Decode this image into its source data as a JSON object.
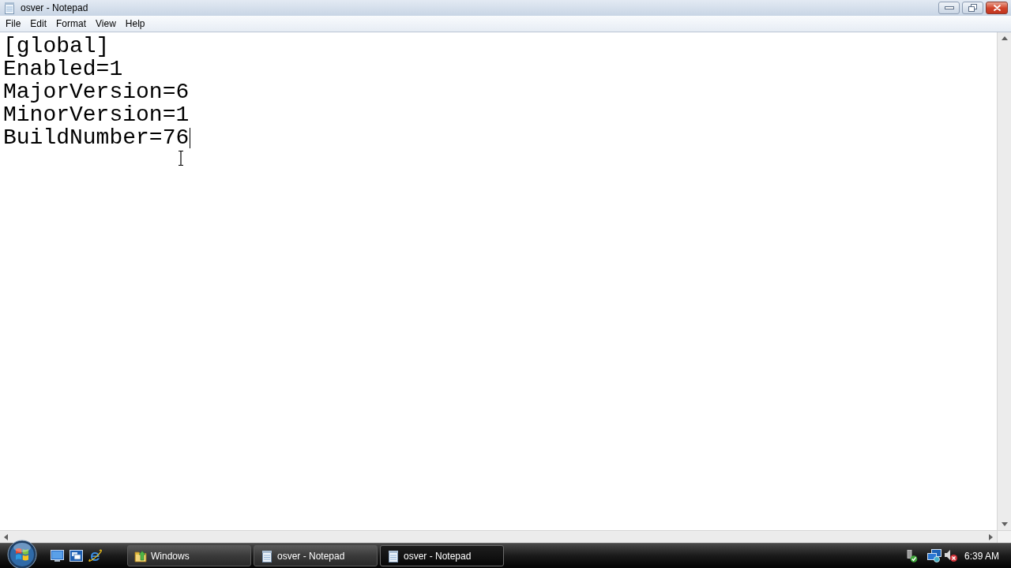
{
  "window": {
    "title": "osver - Notepad"
  },
  "menu": [
    "File",
    "Edit",
    "Format",
    "View",
    "Help"
  ],
  "editor": {
    "lines": [
      {
        "text": "[global]",
        "caret": false
      },
      {
        "text": "Enabled=1",
        "caret": false
      },
      {
        "text": "MajorVersion=6",
        "caret": false
      },
      {
        "text": "MinorVersion=1",
        "caret": false
      },
      {
        "text": "BuildNumber=76",
        "caret": true
      }
    ]
  },
  "taskbar": {
    "tasks": [
      {
        "label": "Windows",
        "kind": "folder",
        "selected": false
      },
      {
        "label": "osver - Notepad",
        "kind": "notepad",
        "selected": false
      },
      {
        "label": "osver - Notepad",
        "kind": "notepad",
        "selected": true
      }
    ],
    "clock": "6:39 AM"
  }
}
